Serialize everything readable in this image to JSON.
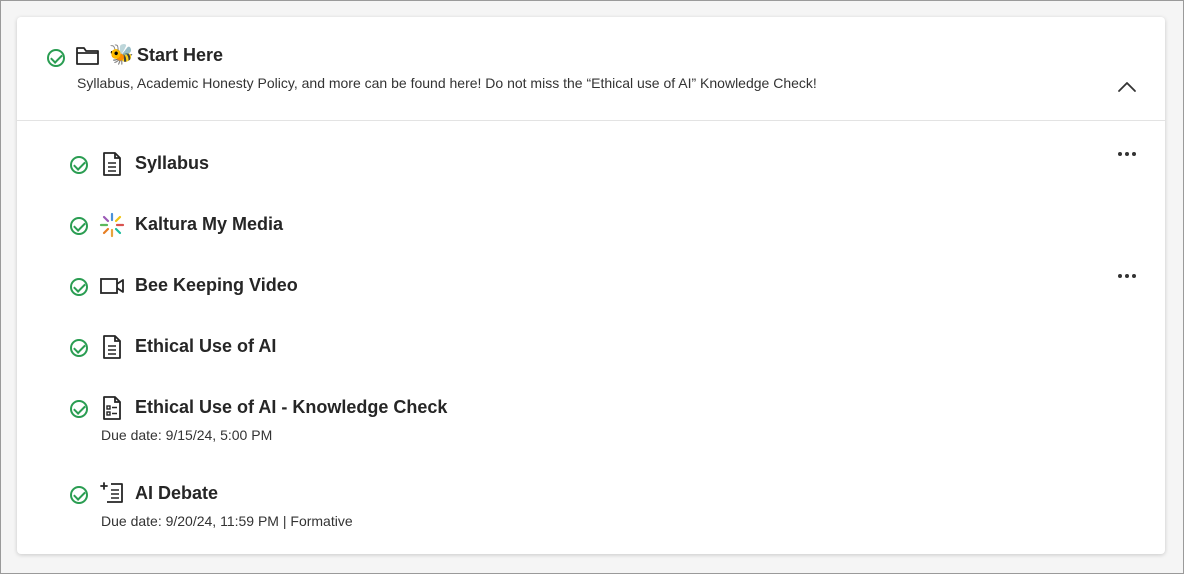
{
  "folder": {
    "title": "Start Here",
    "emoji": "🐝",
    "description": "Syllabus, Academic Honesty Policy, and more can be found here! Do not miss the “Ethical use of AI” Knowledge Check!",
    "icon": "folder-icon",
    "status_icon": "check-circle-icon",
    "collapse_icon": "chevron-up-icon"
  },
  "items": [
    {
      "title": "Syllabus",
      "icon": "document-icon",
      "meta": ""
    },
    {
      "title": "Kaltura My Media",
      "icon": "kaltura-icon",
      "meta": ""
    },
    {
      "title": "Bee Keeping Video",
      "icon": "video-icon",
      "meta": ""
    },
    {
      "title": "Ethical Use of AI",
      "icon": "document-icon",
      "meta": ""
    },
    {
      "title": "Ethical Use of AI - Knowledge Check",
      "icon": "test-icon",
      "meta": "Due date: 9/15/24, 5:00 PM"
    },
    {
      "title": "AI Debate",
      "icon": "discussion-icon",
      "meta": "Due date: 9/20/24, 11:59 PM | Formative"
    }
  ],
  "colors": {
    "complete_green": "#2a9d52",
    "text": "#262626",
    "border": "#e3e3e3"
  }
}
